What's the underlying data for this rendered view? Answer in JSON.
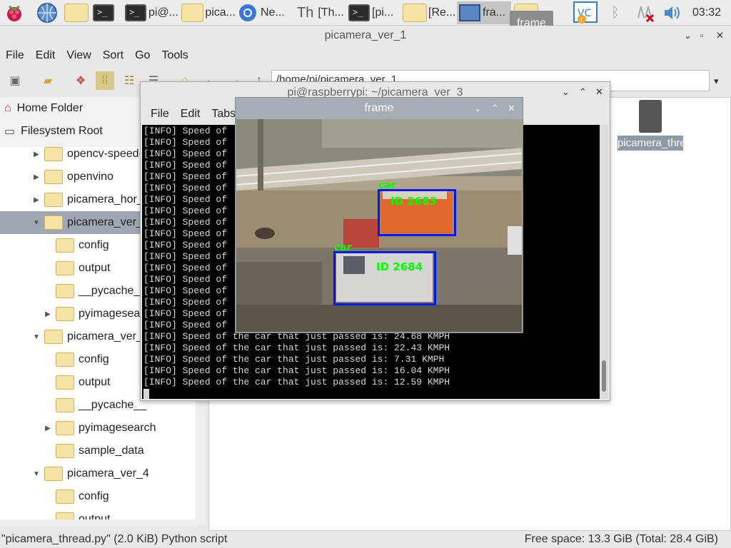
{
  "taskbar": {
    "items": [
      "pi@...",
      "pica...",
      "Ne...",
      "[Th...",
      "[pi...",
      "[Re...",
      "fra..."
    ],
    "clock": "03:32",
    "tooltip": "frame"
  },
  "file_manager": {
    "title": "picamera_ver_1",
    "menu": [
      "File",
      "Edit",
      "View",
      "Sort",
      "Go",
      "Tools"
    ],
    "path": "/home/pi/picamera_ver_1",
    "places": [
      "Home Folder",
      "Filesystem Root"
    ],
    "tree": [
      {
        "label": "opencv-speed-",
        "arrow": "right"
      },
      {
        "label": "openvino",
        "arrow": "right"
      },
      {
        "label": "picamera_hor_",
        "arrow": "right"
      },
      {
        "label": "picamera_ver_1",
        "arrow": "down"
      },
      {
        "label": "config",
        "arrow": ""
      },
      {
        "label": "output",
        "arrow": ""
      },
      {
        "label": "__pycache__",
        "arrow": ""
      },
      {
        "label": "pyimagesearch",
        "arrow": "right"
      },
      {
        "label": "picamera_ver_3",
        "arrow": "down"
      },
      {
        "label": "config",
        "arrow": ""
      },
      {
        "label": "output",
        "arrow": ""
      },
      {
        "label": "__pycache__",
        "arrow": ""
      },
      {
        "label": "pyimagesearch",
        "arrow": "right"
      },
      {
        "label": "sample_data",
        "arrow": ""
      },
      {
        "label": "picamera_ver_4",
        "arrow": "down"
      },
      {
        "label": "config",
        "arrow": ""
      },
      {
        "label": "output",
        "arrow": ""
      }
    ],
    "file": "picamera_thread.py",
    "status_left": "\"picamera_thread.py\" (2.0 KiB) Python script",
    "status_right": "Free space: 13.3 GiB (Total: 28.4 GiB)"
  },
  "terminal": {
    "title": "pi@raspberrypi: ~/picamera_ver_3",
    "menu": [
      "File",
      "Edit",
      "Tabs"
    ],
    "partial_line": "[INFO] Speed of",
    "partial_count": 18,
    "lines": [
      "[INFO] Speed of the car that just passed is: 24.68 KMPH",
      "[INFO] Speed of the car that just passed is: 22.43 KMPH",
      "[INFO] Speed of the car that just passed is: 7.31 KMPH",
      "[INFO] Speed of the car that just passed is: 16.04 KMPH",
      "[INFO] Speed of the car that just passed is: 12.59 KMPH"
    ]
  },
  "frame_window": {
    "title": "frame",
    "detections": [
      {
        "class": "car",
        "id": "ID 2683"
      },
      {
        "class": "car",
        "id": "ID 2684"
      }
    ]
  }
}
